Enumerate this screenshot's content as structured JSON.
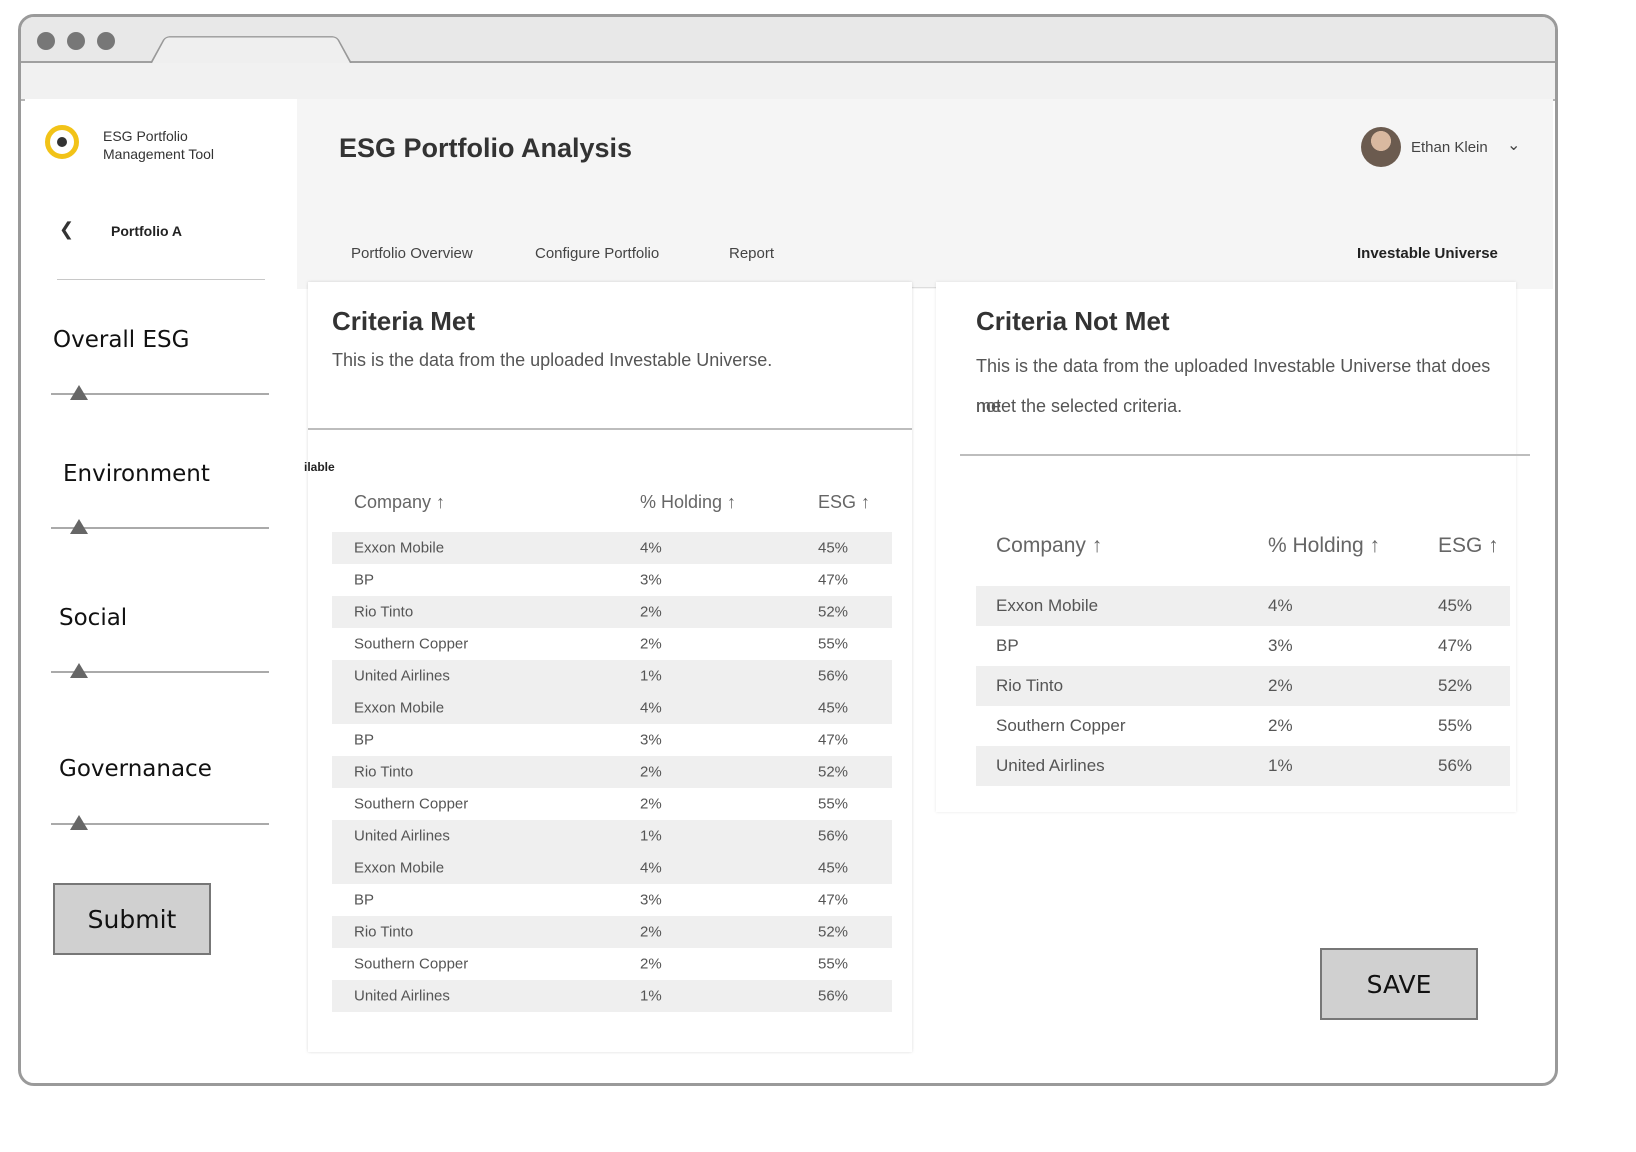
{
  "app": {
    "name_line1": "ESG Portfolio",
    "name_line2": "Management Tool",
    "page_title": "ESG Portfolio Analysis",
    "user_name": "Ethan Klein"
  },
  "sidebar": {
    "back_icon": "chevron-left-icon",
    "portfolio_name": "Portfolio A",
    "sliders": [
      {
        "label": "Overall ESG",
        "value": 0.13
      },
      {
        "label": "Environment",
        "value": 0.13
      },
      {
        "label": "Social",
        "value": 0.13
      },
      {
        "label": "Governanace",
        "value": 0.13
      }
    ],
    "submit_label": "Submit"
  },
  "tabs": [
    {
      "label": "Portfolio Overview",
      "active": false
    },
    {
      "label": "Configure Portfolio",
      "active": false
    },
    {
      "label": "Report",
      "active": false
    },
    {
      "label": "Investable Universe",
      "active": true
    }
  ],
  "criteria_met": {
    "title": "Criteria Met",
    "description": "This is the data from the uploaded Investable Universe.",
    "fragment": "ilable",
    "columns": [
      "Company ↑",
      "% Holding ↑",
      "ESG ↑"
    ],
    "rows": [
      [
        "Exxon Mobile",
        "4%",
        "45%"
      ],
      [
        "BP",
        "3%",
        "47%"
      ],
      [
        "Rio Tinto",
        "2%",
        "52%"
      ],
      [
        "Southern Copper",
        "2%",
        "55%"
      ],
      [
        "United Airlines",
        "1%",
        "56%"
      ],
      [
        "Exxon Mobile",
        "4%",
        "45%"
      ],
      [
        "BP",
        "3%",
        "47%"
      ],
      [
        "Rio Tinto",
        "2%",
        "52%"
      ],
      [
        "Southern Copper",
        "2%",
        "55%"
      ],
      [
        "United Airlines",
        "1%",
        "56%"
      ],
      [
        "Exxon Mobile",
        "4%",
        "45%"
      ],
      [
        "BP",
        "3%",
        "47%"
      ],
      [
        "Rio Tinto",
        "2%",
        "52%"
      ],
      [
        "Southern Copper",
        "2%",
        "55%"
      ],
      [
        "United Airlines",
        "1%",
        "56%"
      ]
    ]
  },
  "criteria_not_met": {
    "title": "Criteria Not Met",
    "description_line1": "This is the data from the uploaded Investable Universe that does not",
    "description_line2": "meet the selected criteria.",
    "columns": [
      "Company ↑",
      "% Holding ↑",
      "ESG ↑"
    ],
    "rows": [
      [
        "Exxon Mobile",
        "4%",
        "45%"
      ],
      [
        "BP",
        "3%",
        "47%"
      ],
      [
        "Rio Tinto",
        "2%",
        "52%"
      ],
      [
        "Southern Copper",
        "2%",
        "55%"
      ],
      [
        "United Airlines",
        "1%",
        "56%"
      ]
    ]
  },
  "save_label": "SAVE",
  "colors": {
    "accent_tab": "#e03a3a",
    "logo": "#f2c318"
  }
}
